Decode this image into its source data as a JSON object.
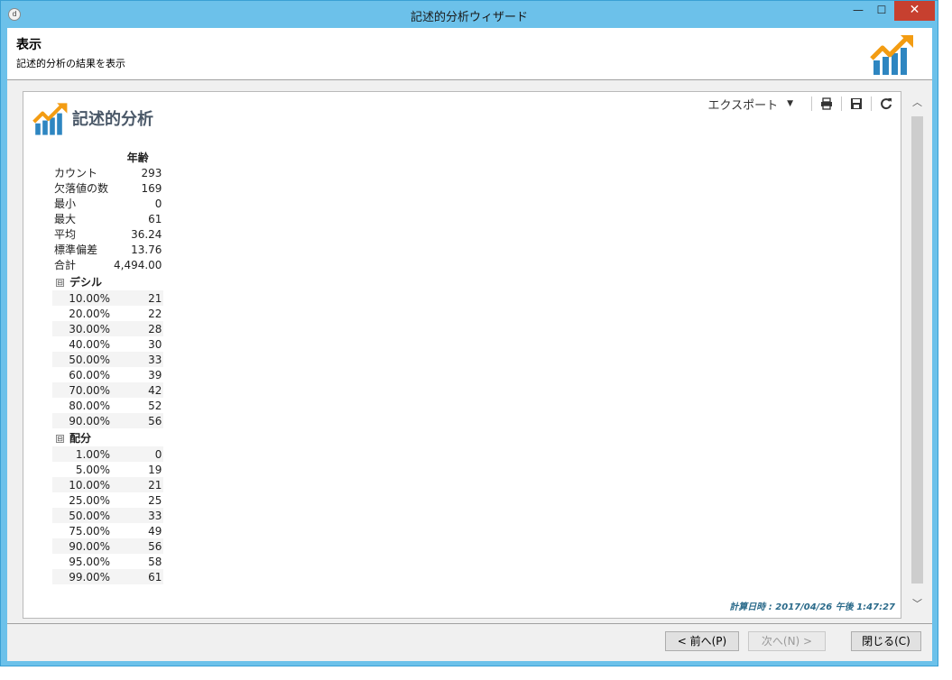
{
  "window": {
    "title": "記述的分析ウィザード",
    "icon_text": "d",
    "controls": {
      "minimize": "—",
      "maximize": "☐",
      "close": "✕"
    }
  },
  "header": {
    "title": "表示",
    "subtitle": "記述的分析の結果を表示"
  },
  "toolbar": {
    "export_label": "エクスポート",
    "caret": "▼"
  },
  "report": {
    "title": "記述的分析",
    "column_header": "年齢",
    "stats": [
      {
        "label": "カウント",
        "value": "293"
      },
      {
        "label": "欠落値の数",
        "value": "169"
      },
      {
        "label": "最小",
        "value": "0"
      },
      {
        "label": "最大",
        "value": "61"
      },
      {
        "label": "平均",
        "value": "36.24"
      },
      {
        "label": "標準偏差",
        "value": "13.76"
      },
      {
        "label": "合計",
        "value": "4,494.00"
      }
    ],
    "deciles": {
      "label": "デシル",
      "rows": [
        {
          "pct": "10.00%",
          "value": "21"
        },
        {
          "pct": "20.00%",
          "value": "22"
        },
        {
          "pct": "30.00%",
          "value": "28"
        },
        {
          "pct": "40.00%",
          "value": "30"
        },
        {
          "pct": "50.00%",
          "value": "33"
        },
        {
          "pct": "60.00%",
          "value": "39"
        },
        {
          "pct": "70.00%",
          "value": "42"
        },
        {
          "pct": "80.00%",
          "value": "52"
        },
        {
          "pct": "90.00%",
          "value": "56"
        }
      ]
    },
    "distribution": {
      "label": "配分",
      "rows": [
        {
          "pct": "1.00%",
          "value": "0"
        },
        {
          "pct": "5.00%",
          "value": "19"
        },
        {
          "pct": "10.00%",
          "value": "21"
        },
        {
          "pct": "25.00%",
          "value": "25"
        },
        {
          "pct": "50.00%",
          "value": "33"
        },
        {
          "pct": "75.00%",
          "value": "49"
        },
        {
          "pct": "90.00%",
          "value": "56"
        },
        {
          "pct": "95.00%",
          "value": "58"
        },
        {
          "pct": "99.00%",
          "value": "61"
        }
      ]
    },
    "toggle_symbol": "⊟",
    "computed_at": "計算日時 : 2017/04/26 午後 1:47:27"
  },
  "scrollbar": {
    "up": "︿",
    "down": "﹀"
  },
  "buttons": {
    "prev": "< 前へ(P)",
    "next": "次へ(N) >",
    "close": "閉じる(C)"
  },
  "colors": {
    "titlebar": "#6cc1ea",
    "close_button": "#c7402f",
    "logo_orange": "#f39c12",
    "logo_blue": "#2e86c1",
    "report_title": "#4a5868",
    "computed_text": "#2a6a8a"
  }
}
